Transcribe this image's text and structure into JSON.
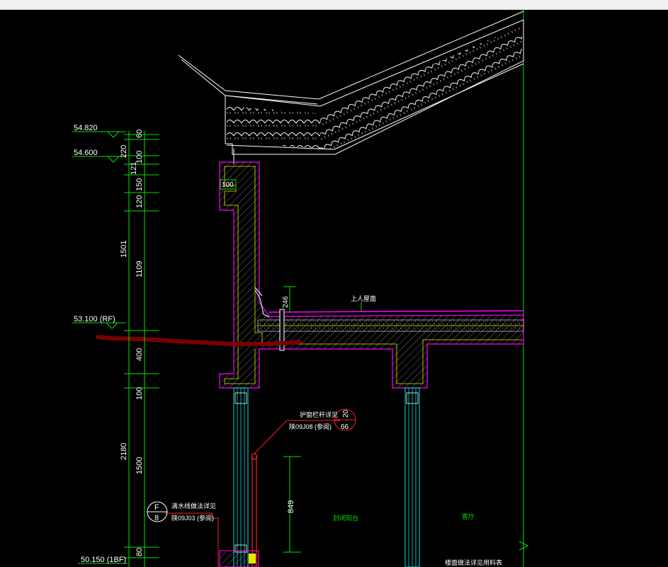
{
  "levels": {
    "l1": "54.820",
    "l2": "54.600",
    "l3": "53.100 (RF)",
    "l4": "50.150 (1BF)"
  },
  "dims_outer": [
    "60",
    "220",
    "121",
    "1501",
    "400",
    "2180"
  ],
  "dims_inner": [
    "100",
    "150",
    "120",
    "1109",
    "100",
    "1500",
    "80"
  ],
  "dims_other": [
    "100",
    "246",
    "849"
  ],
  "callouts": {
    "c1_title": "护窗栏杆详见",
    "c1_ref": "陕09J08 (参阅)",
    "c1_num_top": "20",
    "c1_num_bot": "66",
    "c2_title": "滴水线做法详见",
    "c2_ref": "陕09J03 (参阅)",
    "c2_num_top": "F",
    "c2_num_bot": "8"
  },
  "labels": {
    "roof": "上人屋面",
    "balcony": "封闭阳台",
    "living": "客厅",
    "note": "楼面做法详见用料表"
  },
  "colors": {
    "green": "#00e000",
    "magenta": "#ff00ff",
    "cyan": "#00e0e0",
    "red": "#ff2020",
    "yellow": "#e8e800",
    "darkred": "#7a0000",
    "white": "#ffffff"
  }
}
